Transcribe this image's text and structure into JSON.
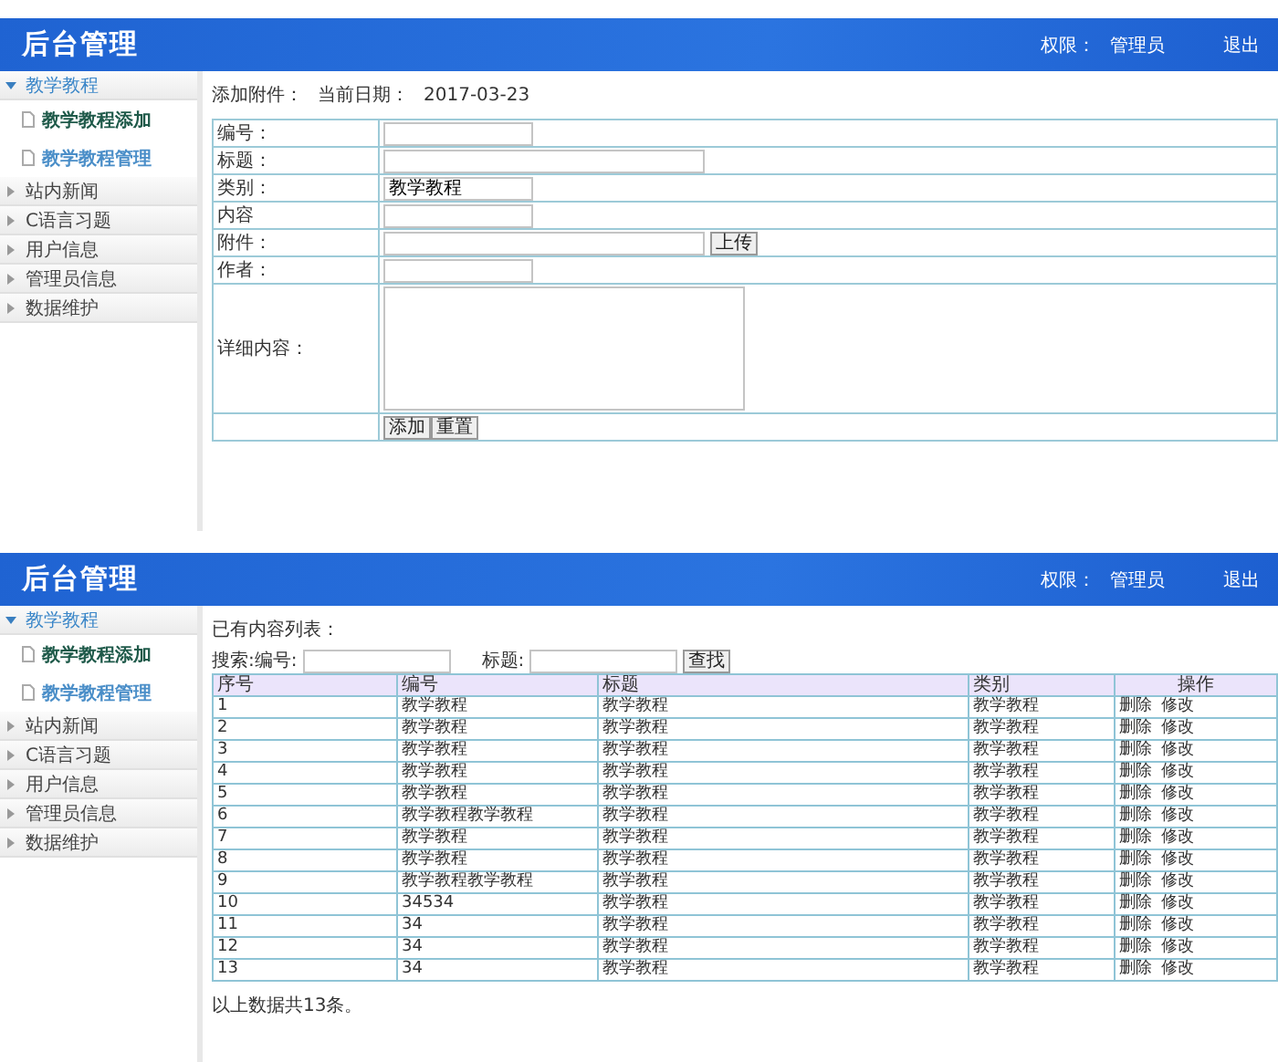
{
  "screens": [
    {
      "header": {
        "title": "后台管理",
        "role_label": "权限：",
        "role": "管理员",
        "logout": "退出"
      },
      "sidebar": [
        {
          "label": "教学教程",
          "expanded": true,
          "children": [
            {
              "label": "教学教程添加",
              "selected": false
            },
            {
              "label": "教学教程管理",
              "selected": true
            }
          ]
        },
        {
          "label": "站内新闻",
          "expanded": false
        },
        {
          "label": "C语言习题",
          "expanded": false
        },
        {
          "label": "用户信息",
          "expanded": false
        },
        {
          "label": "管理员信息",
          "expanded": false
        },
        {
          "label": "数据维护",
          "expanded": false
        }
      ],
      "content": {
        "kind": "form",
        "heading": "添加附件：",
        "date_label": "当前日期：",
        "date": "2017-03-23",
        "fields": [
          {
            "label": "编号：",
            "kind": "short"
          },
          {
            "label": "标题：",
            "kind": "long"
          },
          {
            "label": "类别：",
            "kind": "short",
            "value": "教学教程"
          },
          {
            "label": "内容",
            "kind": "short"
          },
          {
            "label": "附件：",
            "kind": "file",
            "button": "上传"
          },
          {
            "label": "作者：",
            "kind": "short"
          },
          {
            "label": "详细内容：",
            "kind": "textarea"
          }
        ],
        "buttons": [
          "添加",
          "重置"
        ]
      }
    },
    {
      "header": {
        "title": "后台管理",
        "role_label": "权限：",
        "role": "管理员",
        "logout": "退出"
      },
      "sidebar": [
        {
          "label": "教学教程",
          "expanded": true,
          "children": [
            {
              "label": "教学教程添加",
              "selected": false
            },
            {
              "label": "教学教程管理",
              "selected": true
            }
          ]
        },
        {
          "label": "站内新闻",
          "expanded": false
        },
        {
          "label": "C语言习题",
          "expanded": false
        },
        {
          "label": "用户信息",
          "expanded": false
        },
        {
          "label": "管理员信息",
          "expanded": false
        },
        {
          "label": "数据维护",
          "expanded": false
        }
      ],
      "content": {
        "kind": "list",
        "heading": "已有内容列表：",
        "search_label": "搜索:编号:",
        "title_label": "标题:",
        "search_button": "查找",
        "columns": [
          "序号",
          "编号",
          "标题",
          "类别",
          "操作"
        ],
        "rows": [
          {
            "cells": [
              "1",
              "教学教程",
              "教学教程",
              "教学教程"
            ],
            "actions": [
              "删除",
              "修改"
            ]
          },
          {
            "cells": [
              "2",
              "教学教程",
              "教学教程",
              "教学教程"
            ],
            "actions": [
              "删除",
              "修改"
            ]
          },
          {
            "cells": [
              "3",
              "教学教程",
              "教学教程",
              "教学教程"
            ],
            "actions": [
              "删除",
              "修改"
            ]
          },
          {
            "cells": [
              "4",
              "教学教程",
              "教学教程",
              "教学教程"
            ],
            "actions": [
              "删除",
              "修改"
            ]
          },
          {
            "cells": [
              "5",
              "教学教程",
              "教学教程",
              "教学教程"
            ],
            "actions": [
              "删除",
              "修改"
            ]
          },
          {
            "cells": [
              "6",
              "教学教程教学教程",
              "教学教程",
              "教学教程"
            ],
            "actions": [
              "删除",
              "修改"
            ]
          },
          {
            "cells": [
              "7",
              "教学教程",
              "教学教程",
              "教学教程"
            ],
            "actions": [
              "删除",
              "修改"
            ]
          },
          {
            "cells": [
              "8",
              "教学教程",
              "教学教程",
              "教学教程"
            ],
            "actions": [
              "删除",
              "修改"
            ]
          },
          {
            "cells": [
              "9",
              "教学教程教学教程",
              "教学教程",
              "教学教程"
            ],
            "actions": [
              "删除",
              "修改"
            ]
          },
          {
            "cells": [
              "10",
              "34534",
              "教学教程",
              "教学教程"
            ],
            "actions": [
              "删除",
              "修改"
            ]
          },
          {
            "cells": [
              "11",
              "34",
              "教学教程",
              "教学教程"
            ],
            "actions": [
              "删除",
              "修改"
            ]
          },
          {
            "cells": [
              "12",
              "34",
              "教学教程",
              "教学教程"
            ],
            "actions": [
              "删除",
              "修改"
            ]
          },
          {
            "cells": [
              "13",
              "34",
              "教学教程",
              "教学教程"
            ],
            "actions": [
              "删除",
              "修改"
            ]
          }
        ],
        "footer": "以上数据共13条。"
      }
    }
  ]
}
